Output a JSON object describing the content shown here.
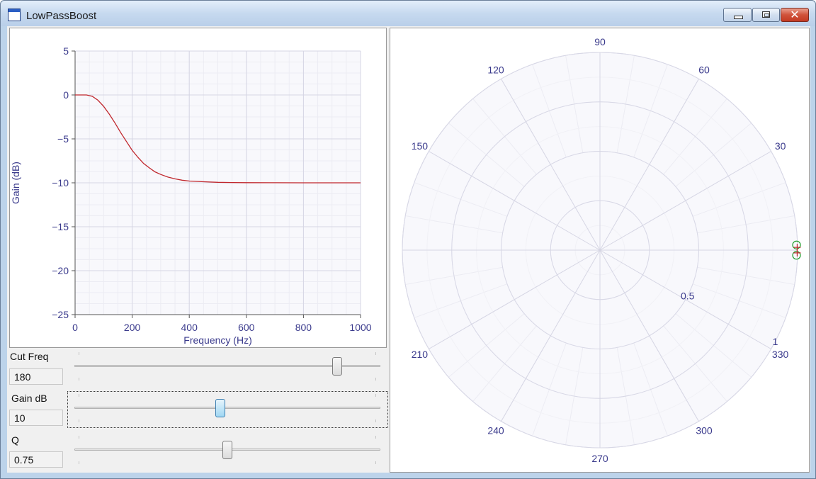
{
  "window": {
    "title": "LowPassBoost",
    "close_glyph": "✕"
  },
  "colors": {
    "curve": "#c0272d",
    "marker": "#1f9e2a",
    "axis_text": "#3a3a8c",
    "grid": "#dcdce8"
  },
  "chart_data": [
    {
      "type": "line",
      "title": "",
      "xlabel": "Frequency (Hz)",
      "ylabel": "Gain (dB)",
      "xlim": [
        0,
        1000
      ],
      "ylim": [
        -25,
        5
      ],
      "xticks": [
        0,
        200,
        400,
        600,
        800,
        1000
      ],
      "yticks": [
        5,
        0,
        -5,
        -10,
        -15,
        -20,
        -25
      ],
      "ytick_labels": [
        "5",
        "0",
        "−5",
        "−10",
        "−15",
        "−20",
        "−25"
      ],
      "grid": true,
      "series": [
        {
          "x": [
            0,
            20,
            40,
            60,
            80,
            100,
            120,
            140,
            160,
            180,
            200,
            220,
            240,
            260,
            280,
            300,
            325,
            350,
            375,
            400,
            450,
            500,
            550,
            600,
            700,
            800,
            900,
            1000
          ],
          "values": [
            0,
            0.0,
            0.0,
            -0.15,
            -0.6,
            -1.3,
            -2.2,
            -3.2,
            -4.3,
            -5.3,
            -6.3,
            -7.1,
            -7.8,
            -8.3,
            -8.75,
            -9.05,
            -9.35,
            -9.55,
            -9.7,
            -9.8,
            -9.88,
            -9.94,
            -9.97,
            -9.98,
            -9.99,
            -10,
            -10,
            -10
          ]
        }
      ]
    },
    {
      "type": "scatter",
      "subtype": "polar",
      "angle_labels": [
        "90",
        "60",
        "30",
        "330",
        "300",
        "270",
        "240",
        "210",
        "150",
        "120"
      ],
      "angle_label_angles": [
        90,
        60,
        30,
        330,
        300,
        270,
        240,
        210,
        150,
        120
      ],
      "radial_labels": [
        "0.5",
        "1"
      ],
      "radial_label_values": [
        0.5,
        1
      ],
      "rmax": 1.0,
      "grid": true,
      "series": [
        {
          "marker": "circle",
          "points": [
            {
              "r": 0.995,
              "theta": 1.5
            },
            {
              "r": 0.995,
              "theta": -1.5
            }
          ]
        },
        {
          "marker": "cross",
          "points": [
            {
              "r": 0.998,
              "theta": 0.8
            },
            {
              "r": 0.998,
              "theta": -0.8
            }
          ]
        }
      ]
    }
  ],
  "controls": [
    {
      "label": "Cut Freq",
      "value": "180",
      "position": 0.87
    },
    {
      "label": "Gain dB",
      "value": "10",
      "position": 0.475
    },
    {
      "label": "Q",
      "value": "0.75",
      "position": 0.5
    }
  ]
}
